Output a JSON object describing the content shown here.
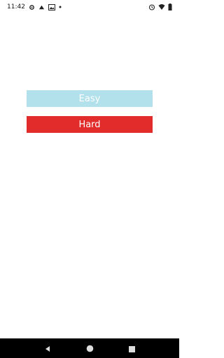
{
  "status_bar": {
    "time": "11:42",
    "icons_left": [
      "gear-icon",
      "cast-icon",
      "image-icon",
      "dot-icon"
    ],
    "icons_right": [
      "alarm-icon",
      "wifi-icon",
      "battery-icon"
    ]
  },
  "buttons": {
    "easy_label": "Easy",
    "hard_label": "Hard"
  },
  "colors": {
    "easy": "#b2e0eb",
    "hard": "#e22b2b",
    "nav_bar": "#000000"
  },
  "nav_bar": {
    "buttons": [
      "back-icon",
      "home-icon",
      "recents-icon"
    ]
  }
}
